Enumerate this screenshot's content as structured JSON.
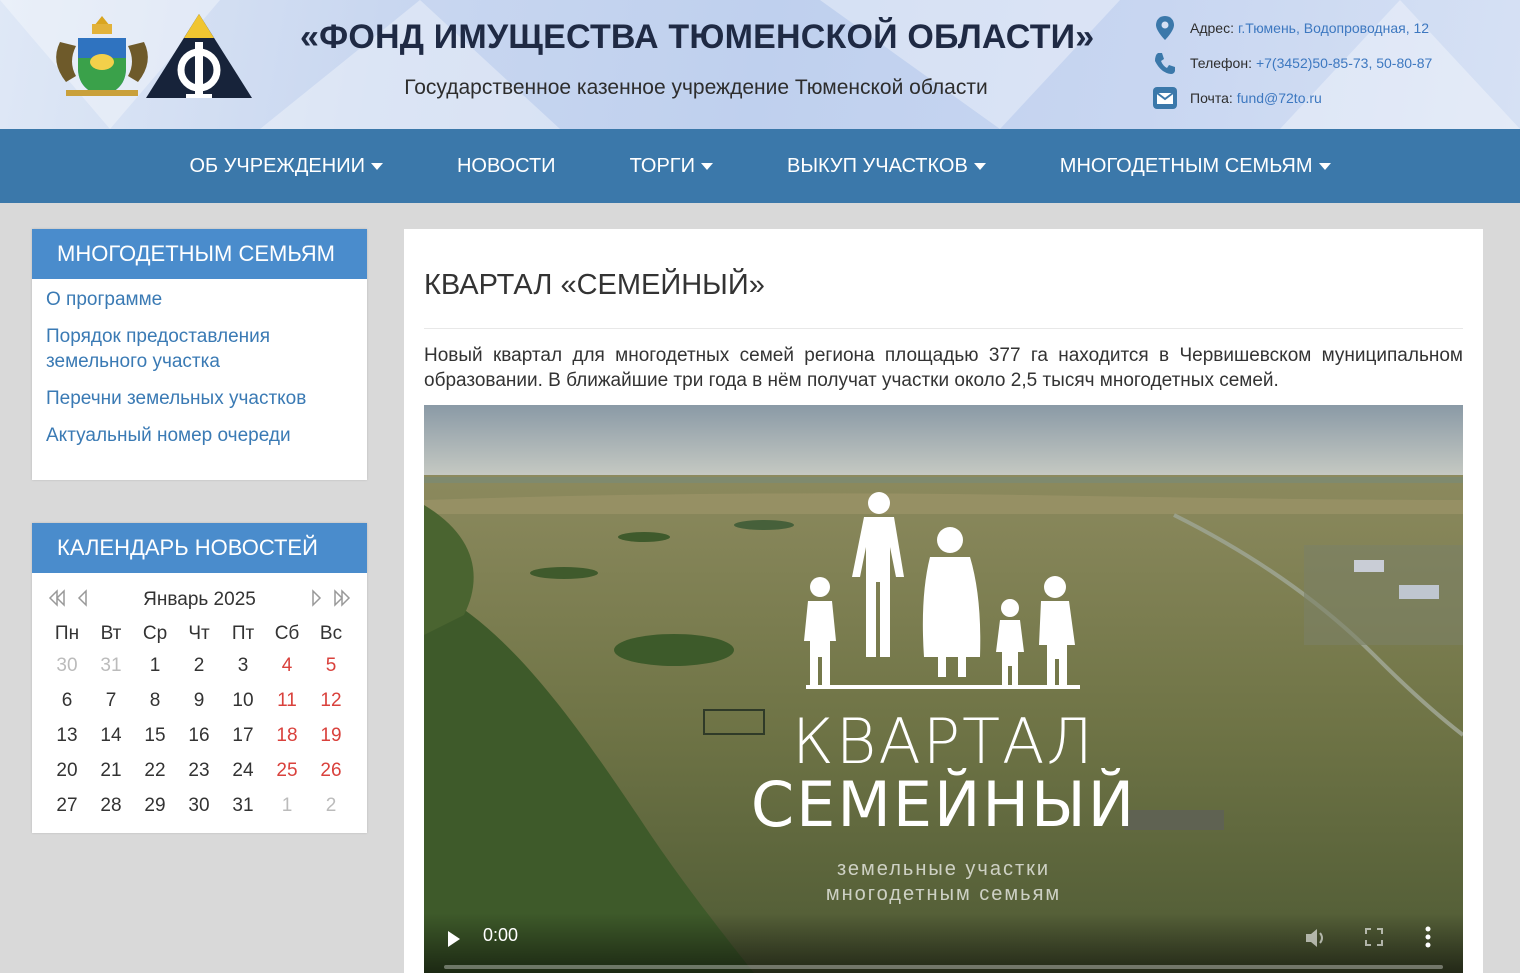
{
  "header": {
    "title": "«ФОНД ИМУЩЕСТВА ТЮМЕНСКОЙ ОБЛАСТИ»",
    "subtitle": "Государственное казенное учреждение Тюменской области",
    "logo_coat_icon": "coat-of-arms-icon",
    "logo_fund_icon": "fund-logo-icon"
  },
  "contacts": {
    "address_label": "Адрес:",
    "address": "г.Тюмень, Водопроводная, 12",
    "phone_label": "Телефон:",
    "phone": "+7(3452)50-85-73, 50-80-87",
    "mail_label": "Почта:",
    "mail": "fund@72to.ru"
  },
  "nav": {
    "items": [
      {
        "label": "ОБ УЧРЕЖДЕНИИ",
        "dropdown": true
      },
      {
        "label": "НОВОСТИ",
        "dropdown": false
      },
      {
        "label": "ТОРГИ",
        "dropdown": true
      },
      {
        "label": "ВЫКУП УЧАСТКОВ",
        "dropdown": true
      },
      {
        "label": "МНОГОДЕТНЫМ СЕМЬЯМ",
        "dropdown": true
      }
    ]
  },
  "sidebar": {
    "menu_title": "МНОГОДЕТНЫМ СЕМЬЯМ",
    "menu_items": [
      "О программе",
      "Порядок предоставления земельного участка",
      "Перечни земельных участков",
      "Актуальный номер очереди"
    ],
    "calendar_title": "КАЛЕНДАРЬ НОВОСТЕЙ",
    "calendar_month": "Январь 2025",
    "weekdays": [
      "Пн",
      "Вт",
      "Ср",
      "Чт",
      "Пт",
      "Сб",
      "Вс"
    ],
    "days": [
      [
        "30",
        "31",
        "1",
        "2",
        "3",
        "4",
        "5"
      ],
      [
        "6",
        "7",
        "8",
        "9",
        "10",
        "11",
        "12"
      ],
      [
        "13",
        "14",
        "15",
        "16",
        "17",
        "18",
        "19"
      ],
      [
        "20",
        "21",
        "22",
        "23",
        "24",
        "25",
        "26"
      ],
      [
        "27",
        "28",
        "29",
        "30",
        "31",
        "1",
        "2"
      ]
    ]
  },
  "main": {
    "title": "КВАРТАЛ «СЕМЕЙНЫЙ»",
    "intro": "Новый квартал для многодетных семей региона площадью 377 га находится в Червишевском муниципальном образовании. В ближайшие три года в нём получат участки около 2,5 тысяч многодетных семей.",
    "video": {
      "title_line1": "КВАРТАЛ",
      "title_line2": "СЕМЕЙНЫЙ",
      "subtitle_line1": "земельные участки",
      "subtitle_line2": "многодетным семьям",
      "time": "0:00",
      "progress": 0
    }
  },
  "colors": {
    "nav_bg": "#3b78aa",
    "widget_head_bg": "#4a8ccc",
    "link": "#3a7ab4",
    "weekend": "#d9413c"
  }
}
